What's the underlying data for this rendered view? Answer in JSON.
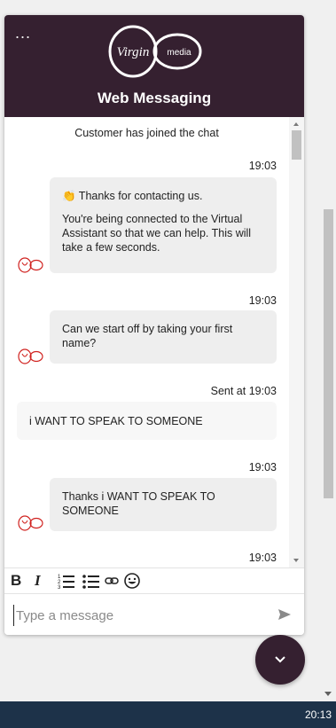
{
  "header": {
    "menu_label": "...",
    "title": "Web Messaging",
    "logo_text_script": "Virgin",
    "logo_text_media": "media"
  },
  "messages": {
    "system": "Customer has joined the chat",
    "items": [
      {
        "timestamp": "19:03",
        "paragraphs": [
          "👏 Thanks for contacting us.",
          "You're being connected to the Virtual Assistant so that we can help. This will take a few seconds."
        ]
      },
      {
        "timestamp": "19:03",
        "text": "Can we start off by taking your first name?"
      },
      {
        "sent_label": "Sent at",
        "timestamp": "19:03",
        "text": "i WANT TO SPEAK TO SOMEONE"
      },
      {
        "timestamp": "19:03",
        "text": "Thanks i WANT TO SPEAK TO SOMEONE"
      },
      {
        "timestamp": "19:03"
      }
    ]
  },
  "toolbar": {
    "bold": "B",
    "italic": "I"
  },
  "composer": {
    "placeholder": "Type a message",
    "value": ""
  },
  "taskbar": {
    "time": "20:13"
  },
  "colors": {
    "brand": "#352030",
    "logo_red": "#d0221f",
    "bubble": "#eeeeee"
  }
}
